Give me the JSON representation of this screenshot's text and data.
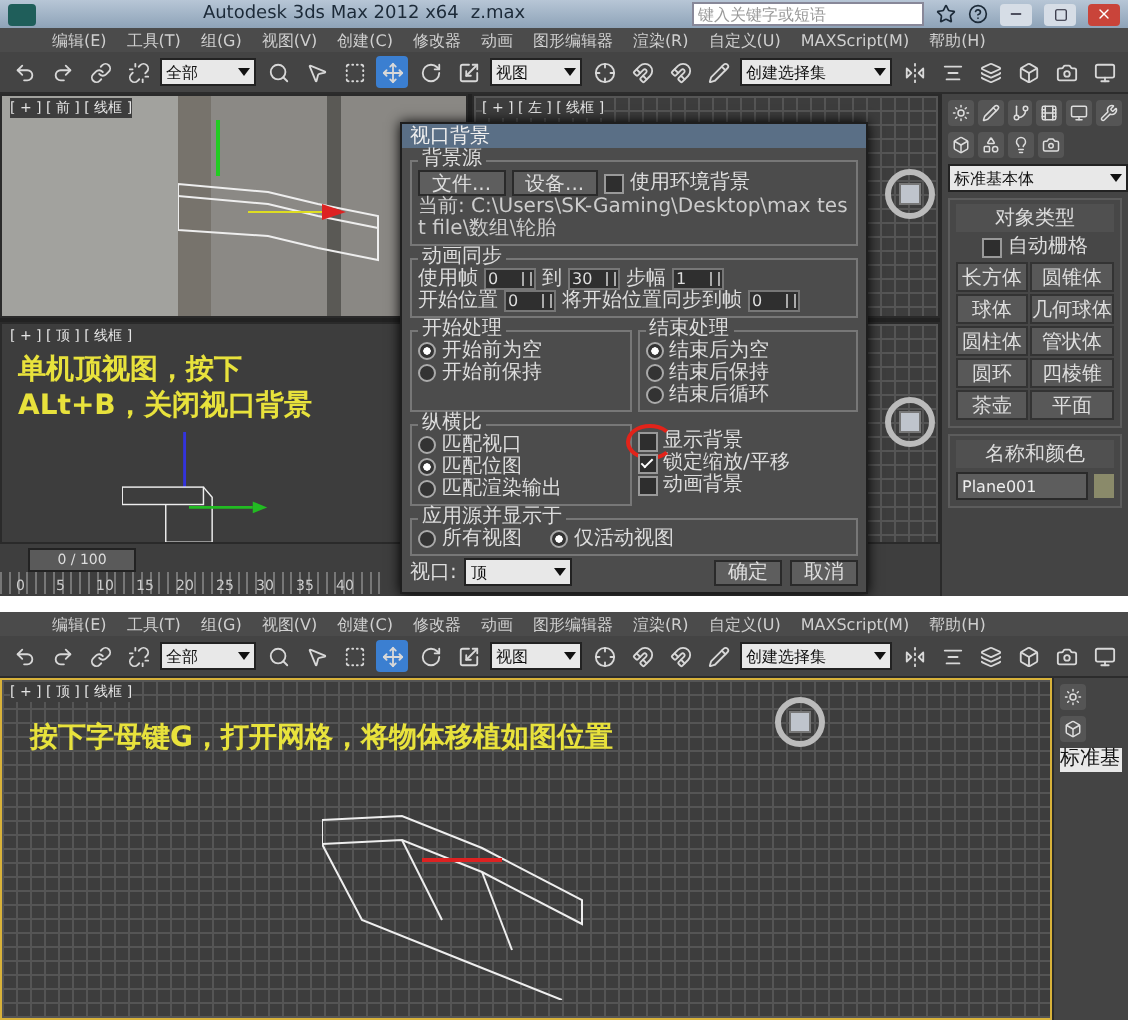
{
  "top_screenshot": {
    "window": {
      "title": "Autodesk 3ds Max  2012 x64",
      "file": "z.max",
      "search_placeholder": "键入关键字或短语"
    },
    "menu": [
      "编辑(E)",
      "工具(T)",
      "组(G)",
      "视图(V)",
      "创建(C)",
      "修改器",
      "动画",
      "图形编辑器",
      "渲染(R)",
      "自定义(U)",
      "MAXScript(M)",
      "帮助(H)"
    ],
    "toolbar": {
      "selection_filter": "全部",
      "reference_coordinate": "视图",
      "named_selection": "创建选择集",
      "tools": [
        {
          "kind": "select",
          "selected": false
        },
        {
          "kind": "region",
          "selected": false
        },
        {
          "kind": "move",
          "selected": true
        },
        {
          "kind": "rotate",
          "selected": false
        },
        {
          "kind": "scale",
          "selected": false
        }
      ]
    },
    "viewports": [
      {
        "kind": "photo",
        "label": "[ + ] [ 前 ] [ 线框 ]"
      },
      {
        "kind": "grid",
        "label": "[ + ] [ 左 ] [ 线框 ]"
      },
      {
        "kind": "dark",
        "label": "[ + ] [ 顶 ] [ 线框 ]",
        "caption": "单机顶视图，按下ALt+B，关闭视口背景"
      },
      {
        "kind": "grid"
      }
    ],
    "timeline": {
      "frame": "0 / 100",
      "level": 0,
      "ticks": [
        "0",
        "5",
        "10",
        "15",
        "20",
        "25",
        "30",
        "35",
        "40"
      ]
    },
    "command_panel": {
      "category": "标准基本体",
      "object_type": {
        "title": "对象类型",
        "autogrid": {
          "label": "自动栅格",
          "checked": false
        },
        "buttons": [
          "长方体",
          "圆锥体",
          "球体",
          "几何球体",
          "圆柱体",
          "管状体",
          "圆环",
          "四棱锥",
          "茶壶",
          "平面"
        ]
      },
      "name_and_color": {
        "title": "名称和颜色",
        "name": "Plane001"
      }
    },
    "dialog": {
      "title": "视口背景",
      "source": {
        "title": "背景源",
        "buttons": [
          "文件...",
          "设备..."
        ],
        "use_environment": {
          "label": "使用环境背景",
          "checked": false
        },
        "current": "当前:  C:\\Users\\SK-Gaming\\Desktop\\max test file\\数组\\轮胎"
      },
      "sync": {
        "title": "动画同步",
        "rows": [
          [
            {
              "label": "使用帧",
              "value": "0"
            },
            {
              "label": "到",
              "value": "30"
            },
            {
              "label": "步幅",
              "value": "1"
            }
          ],
          [
            {
              "label": "开始位置",
              "value": "0"
            },
            {
              "label": "将开始位置同步到帧",
              "value": "0"
            }
          ]
        ]
      },
      "start": {
        "title": "开始处理",
        "options": [
          {
            "label": "开始前为空",
            "selected": true
          },
          {
            "label": "开始前保持",
            "selected": false
          }
        ]
      },
      "end": {
        "title": "结束处理",
        "options": [
          {
            "label": "结束后为空",
            "selected": true
          },
          {
            "label": "结束后保持",
            "selected": false
          },
          {
            "label": "结束后循环",
            "selected": false
          }
        ]
      },
      "aspect": {
        "title": "纵横比",
        "options": [
          {
            "label": "匹配视口",
            "selected": false
          },
          {
            "label": "匹配位图",
            "selected": true
          },
          {
            "label": "匹配渲染输出",
            "selected": false
          }
        ]
      },
      "checks": [
        {
          "label": "显示背景",
          "checked": false,
          "circled": true
        },
        {
          "label": "锁定缩放/平移",
          "checked": true,
          "circled": false
        },
        {
          "label": "动画背景",
          "checked": false,
          "circled": false
        }
      ],
      "apply": {
        "title": "应用源并显示于",
        "options": [
          {
            "label": "所有视图",
            "selected": false
          },
          {
            "label": "仅活动视图",
            "selected": true
          }
        ]
      },
      "viewport": {
        "label": "视口:",
        "value": "顶"
      },
      "buttons": [
        "确定",
        "取消"
      ]
    }
  },
  "bottom_screenshot": {
    "menu": [
      "编辑(E)",
      "工具(T)",
      "组(G)",
      "视图(V)",
      "创建(C)",
      "修改器",
      "动画",
      "图形编辑器",
      "渲染(R)",
      "自定义(U)",
      "MAXScript(M)",
      "帮助(H)"
    ],
    "toolbar": {
      "selection_filter": "全部",
      "reference_coordinate": "视图",
      "named_selection": "创建选择集",
      "tools": [
        {
          "kind": "select",
          "selected": false
        },
        {
          "kind": "region",
          "selected": false
        },
        {
          "kind": "move",
          "selected": true
        },
        {
          "kind": "rotate",
          "selected": false
        },
        {
          "kind": "scale",
          "selected": false
        }
      ]
    },
    "viewport": {
      "label": "[ + ] [ 顶 ] [ 线框 ]",
      "caption": "按下字母键G，打开网格，将物体移植如图位置"
    },
    "command_panel": {
      "category": "标准基"
    }
  }
}
